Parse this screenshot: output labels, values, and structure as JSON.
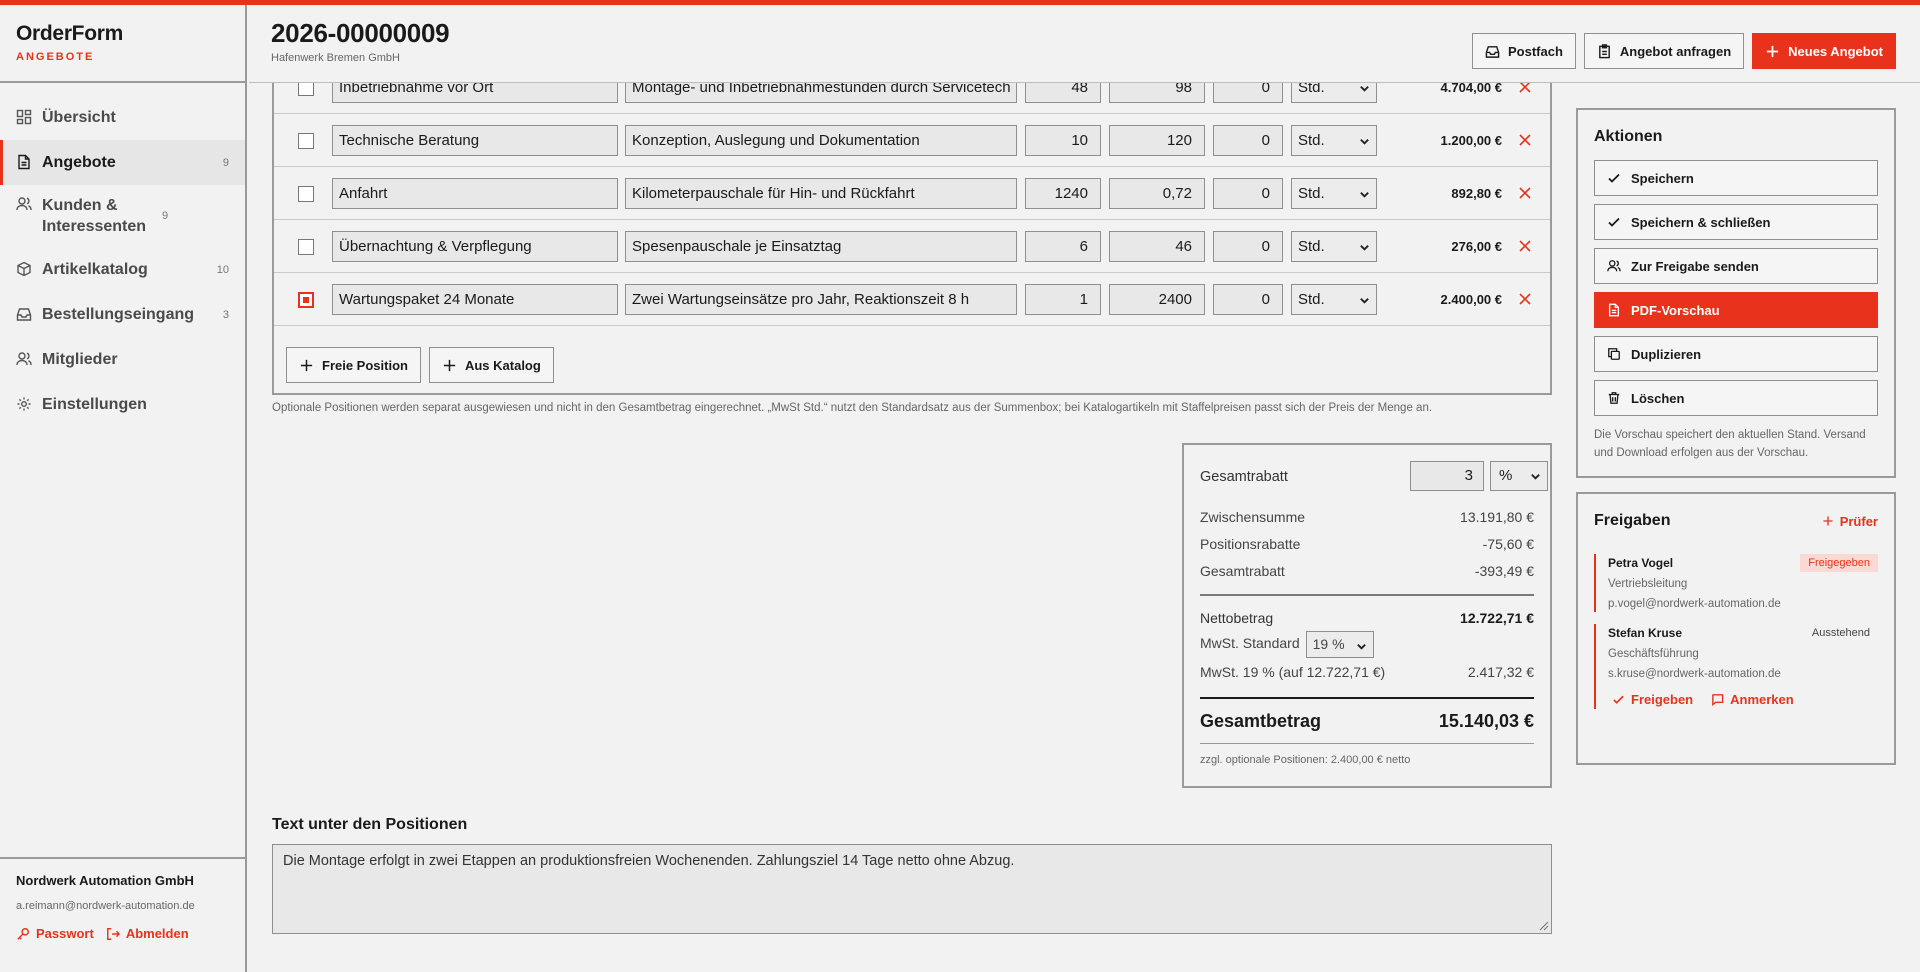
{
  "brand": {
    "name": "OrderForm",
    "sub": "ANGEBOTE"
  },
  "nav": [
    {
      "label": "Übersicht",
      "count": "",
      "icon": "grid-icon"
    },
    {
      "label": "Angebote",
      "count": "9",
      "icon": "document-icon",
      "active": true
    },
    {
      "label": "Kunden & Interessenten",
      "count": "9",
      "icon": "users-icon"
    },
    {
      "label": "Artikelkatalog",
      "count": "10",
      "icon": "box-icon"
    },
    {
      "label": "Bestellungseingang",
      "count": "3",
      "icon": "inbox-icon"
    },
    {
      "label": "Mitglieder",
      "count": "",
      "icon": "members-icon"
    },
    {
      "label": "Einstellungen",
      "count": "",
      "icon": "gear-icon"
    }
  ],
  "footer": {
    "org": "Nordwerk Automation GmbH",
    "email": "a.reimann@nordwerk-automation.de",
    "password": "Passwort",
    "logout": "Abmelden"
  },
  "header": {
    "title": "2026-00000009",
    "subtitle": "Hafenwerk Bremen GmbH",
    "postfach": "Postfach",
    "request": "Angebot anfragen",
    "new_offer": "Neues Angebot"
  },
  "positions": [
    {
      "name": "Inbetriebnahme vor Ort",
      "desc": "Montage- und Inbetriebnahmestunden durch Servicetech",
      "qty": "48",
      "price": "98",
      "disc": "0",
      "unit": "Std.",
      "total": "4.704,00 €",
      "optional": false
    },
    {
      "name": "Technische Beratung",
      "desc": "Konzeption, Auslegung und Dokumentation",
      "qty": "10",
      "price": "120",
      "disc": "0",
      "unit": "Std.",
      "total": "1.200,00 €",
      "optional": false
    },
    {
      "name": "Anfahrt",
      "desc": "Kilometerpauschale für Hin- und Rückfahrt",
      "qty": "1240",
      "price": "0,72",
      "disc": "0",
      "unit": "Std.",
      "total": "892,80 €",
      "optional": false
    },
    {
      "name": "Übernachtung & Verpflegung",
      "desc": "Spesenpauschale je Einsatztag",
      "qty": "6",
      "price": "46",
      "disc": "0",
      "unit": "Std.",
      "total": "276,00 €",
      "optional": false
    },
    {
      "name": "Wartungspaket 24 Monate",
      "desc": "Zwei Wartungseinsätze pro Jahr, Reaktionszeit 8 h",
      "qty": "1",
      "price": "2400",
      "disc": "0",
      "unit": "Std.",
      "total": "2.400,00 €",
      "optional": true
    }
  ],
  "add_buttons": {
    "free": "Freie Position",
    "catalog": "Aus Katalog"
  },
  "hint": "Optionale Positionen werden separat ausgewiesen und nicht in den Gesamtbetrag eingerechnet. „MwSt Std.“ nutzt den Standardsatz aus der Summenbox; bei Katalogartikeln mit Staffelpreisen passt sich der Preis der Menge an.",
  "summary": {
    "discount_label": "Gesamtrabatt",
    "discount_value": "3",
    "discount_type": "%",
    "subtotal_label": "Zwischensumme",
    "subtotal": "13.191,80 €",
    "pos_disc_label": "Positionsrabatte",
    "pos_disc": "-75,60 €",
    "total_disc_label": "Gesamtrabatt",
    "total_disc": "-393,49 €",
    "net_label": "Nettobetrag",
    "net": "12.722,71 €",
    "vat_std_label": "MwSt. Standard",
    "vat_std": "19 %",
    "vat_label": "MwSt. 19 % (auf 12.722,71 €)",
    "vat": "2.417,32 €",
    "grand_label": "Gesamtbetrag",
    "grand": "15.140,03 €",
    "optional_note": "zzgl. optionale Positionen: 2.400,00 € netto"
  },
  "text_below": {
    "title": "Text unter den Positionen",
    "value": "Die Montage erfolgt in zwei Etappen an produktionsfreien Wochenenden. Zahlungsziel 14 Tage netto ohne Abzug."
  },
  "aktionen": {
    "title": "Aktionen",
    "save": "Speichern",
    "save_close": "Speichern & schließen",
    "send_approval": "Zur Freigabe senden",
    "pdf": "PDF-Vorschau",
    "duplicate": "Duplizieren",
    "delete": "Löschen",
    "note": "Die Vorschau speichert den aktuellen Stand. Versand und Download erfolgen aus der Vorschau."
  },
  "freigaben": {
    "title": "Freigaben",
    "add": "Prüfer",
    "approvers": [
      {
        "name": "Petra Vogel",
        "role": "Vertriebsleitung",
        "email": "p.vogel@nordwerk-automation.de",
        "status": "Freigegeben"
      },
      {
        "name": "Stefan Kruse",
        "role": "Geschäftsführung",
        "email": "s.kruse@nordwerk-automation.de",
        "status": "Ausstehend"
      }
    ],
    "approve": "Freigeben",
    "comment": "Anmerken"
  },
  "colors": {
    "accent": "#e8321c",
    "approved_bg": "#fbd9d3"
  }
}
